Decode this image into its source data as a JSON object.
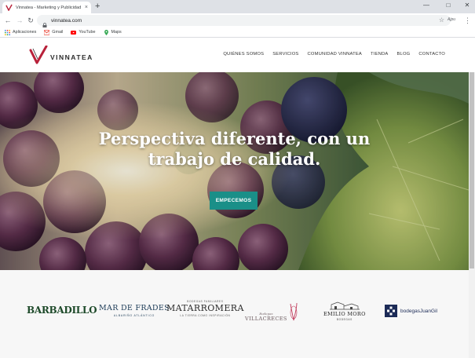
{
  "browser": {
    "tab_title": "Vinnatea - Marketing y Publicidad",
    "tab_close": "×",
    "new_tab": "+",
    "url": "vinnatea.com",
    "profile_label": "Ajpu",
    "bookmarks": [
      {
        "label": "Aplicaciones",
        "icon": "apps-grid-icon"
      },
      {
        "label": "Gmail",
        "icon": "gmail-icon"
      },
      {
        "label": "YouTube",
        "icon": "youtube-icon"
      },
      {
        "label": "Maps",
        "icon": "maps-icon"
      }
    ]
  },
  "site": {
    "logo_text": "VINNATEA",
    "nav": [
      "QUIÉNES SOMOS",
      "SERVICIOS",
      "COMUNIDAD VINNATEA",
      "TIENDA",
      "BLOG",
      "CONTACTO"
    ],
    "hero": {
      "title_line1": "Perspectiva diferente, con un",
      "title_line2": "trabajo de calidad.",
      "cta": "EMPECEMOS"
    },
    "clients": [
      {
        "name": "BARBADILLO"
      },
      {
        "name": "MAR DE FRADES",
        "sub": "ALBARIÑO ATLÁNTICO"
      },
      {
        "pre": "BODEGAS FAMILIARES",
        "name": "MATARROMERA",
        "sub": "LA TIERRA COMO INSPIRACIÓN"
      },
      {
        "pre": "Bodegas",
        "name": "VILLACRECES"
      },
      {
        "name": "EMILIO MORO",
        "sub": "BODEGAS"
      },
      {
        "name": "bodegasJuanGil"
      }
    ]
  },
  "colors": {
    "brand_red": "#b8213a",
    "cta_teal": "#1a8f88",
    "tab_strip": "#dee1e6"
  }
}
